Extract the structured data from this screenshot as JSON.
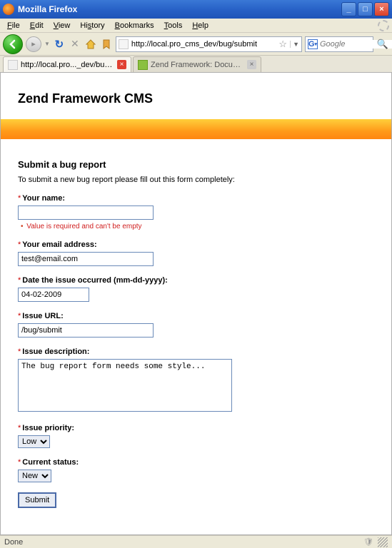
{
  "window": {
    "title": "Mozilla Firefox"
  },
  "menu": {
    "file": "File",
    "edit": "Edit",
    "view": "View",
    "history": "History",
    "bookmarks": "Bookmarks",
    "tools": "Tools",
    "help": "Help"
  },
  "url": "http://local.pro_cms_dev/bug/submit",
  "search": {
    "placeholder": "Google"
  },
  "tabs": [
    {
      "label": "http://local.pro..._dev/bug/submit"
    },
    {
      "label": "Zend Framework: Documentation"
    }
  ],
  "page": {
    "site_title": "Zend Framework CMS",
    "form_title": "Submit a bug report",
    "intro": "To submit a new bug report please fill out this form completely:",
    "fields": {
      "name": {
        "label": "Your name:",
        "value": "",
        "error": "Value is required and can't be empty"
      },
      "email": {
        "label": "Your email address:",
        "value": "test@email.com"
      },
      "date": {
        "label": "Date the issue occurred (mm-dd-yyyy):",
        "value": "04-02-2009"
      },
      "url": {
        "label": "Issue URL:",
        "value": "/bug/submit"
      },
      "desc": {
        "label": "Issue description:",
        "value": "The bug report form needs some style..."
      },
      "priority": {
        "label": "Issue priority:",
        "value": "Low"
      },
      "status": {
        "label": "Current status:",
        "value": "New"
      }
    },
    "submit": "Submit"
  },
  "status": "Done"
}
